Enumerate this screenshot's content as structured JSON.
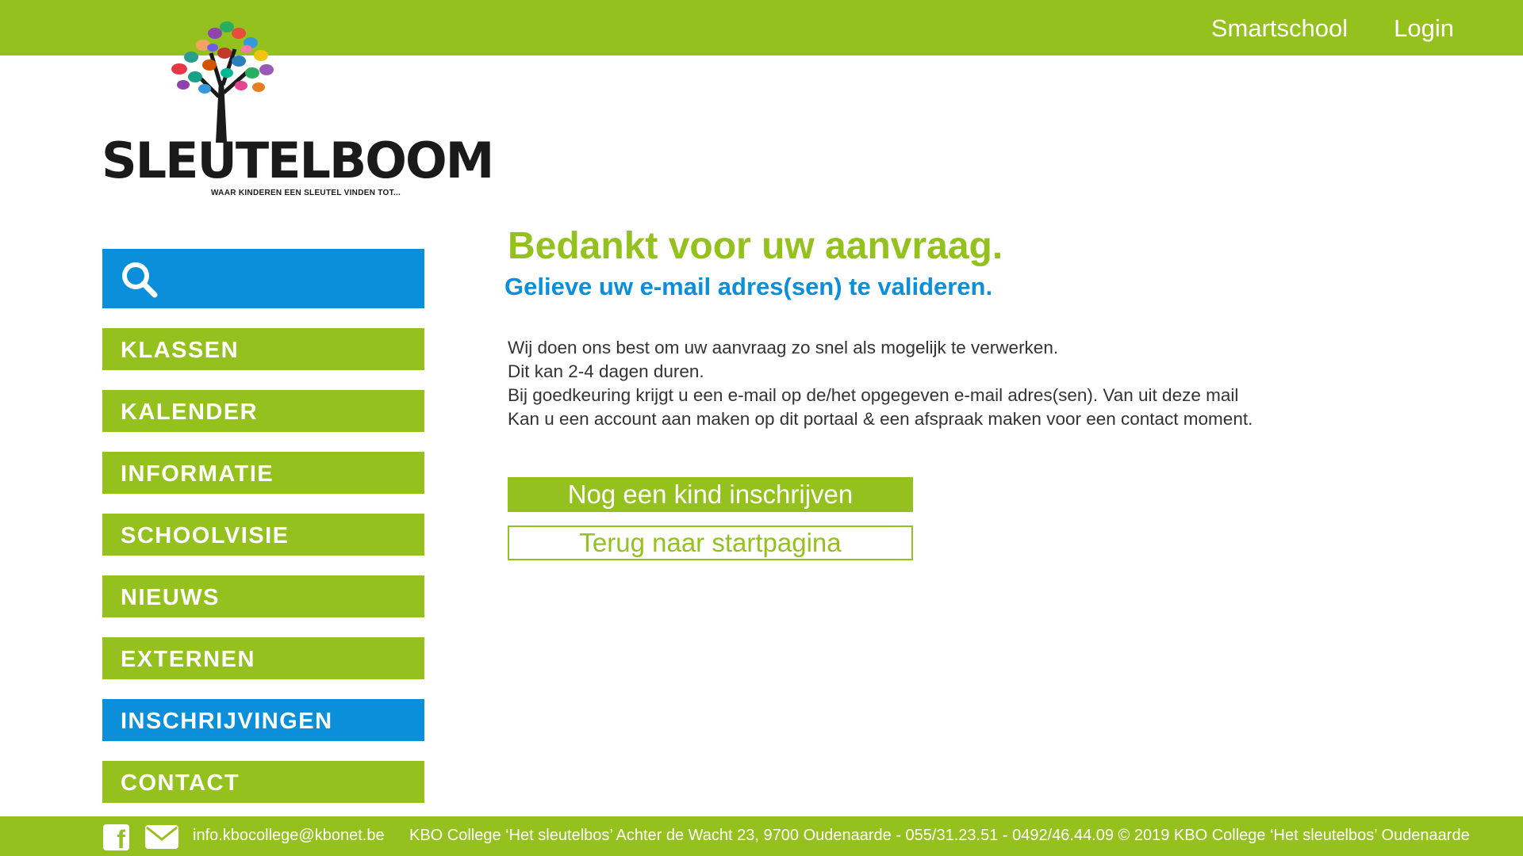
{
  "header": {
    "links": [
      "Smartschool",
      "Login"
    ]
  },
  "logo": {
    "name": "SLEUTELBOOM",
    "tagline": "WAAR KINDEREN EEN SLEUTEL VINDEN TOT..."
  },
  "search": {
    "icon": "search-icon"
  },
  "sidebar": {
    "items": [
      {
        "label": "KLASSEN"
      },
      {
        "label": "KALENDER"
      },
      {
        "label": "INFORMATIE"
      },
      {
        "label": "SCHOOLVISIE"
      },
      {
        "label": "NIEUWS"
      },
      {
        "label": "EXTERNEN"
      },
      {
        "label": "INSCHRIJVINGEN",
        "active": true
      },
      {
        "label": "CONTACT"
      }
    ]
  },
  "main": {
    "title": "Bedankt voor uw aanvraag.",
    "subtitle": "Gelieve uw e-mail adres(sen) te valideren.",
    "paragraph_lines": [
      "Wij doen ons best om uw aanvraag zo snel als mogelijk te verwerken.",
      "Dit kan 2-4 dagen duren.",
      "Bij goedkeuring krijgt u een e-mail op de/het opgegeven e-mail adres(sen). Van uit deze mail",
      "Kan u een account aan maken op dit portaal & een afspraak maken voor een contact moment."
    ],
    "primary_button": "Nog een kind inschrijven",
    "secondary_button": "Terug naar startpagina"
  },
  "footer": {
    "facebook_icon": "facebook-icon",
    "mail_icon": "mail-icon",
    "email": "info.kbocollege@kbonet.be",
    "info": "KBO College ‘Het sleutelbos’ Achter de Wacht 23, 9700 Oudenaarde - 055/31.23.51 - 0492/46.44.09 © 2019 KBO College ‘Het sleutelbos’ Oudenaarde"
  },
  "colors": {
    "green": "#95c11f",
    "blue": "#0b8fdb",
    "white": "#ffffff",
    "text": "#333333"
  }
}
